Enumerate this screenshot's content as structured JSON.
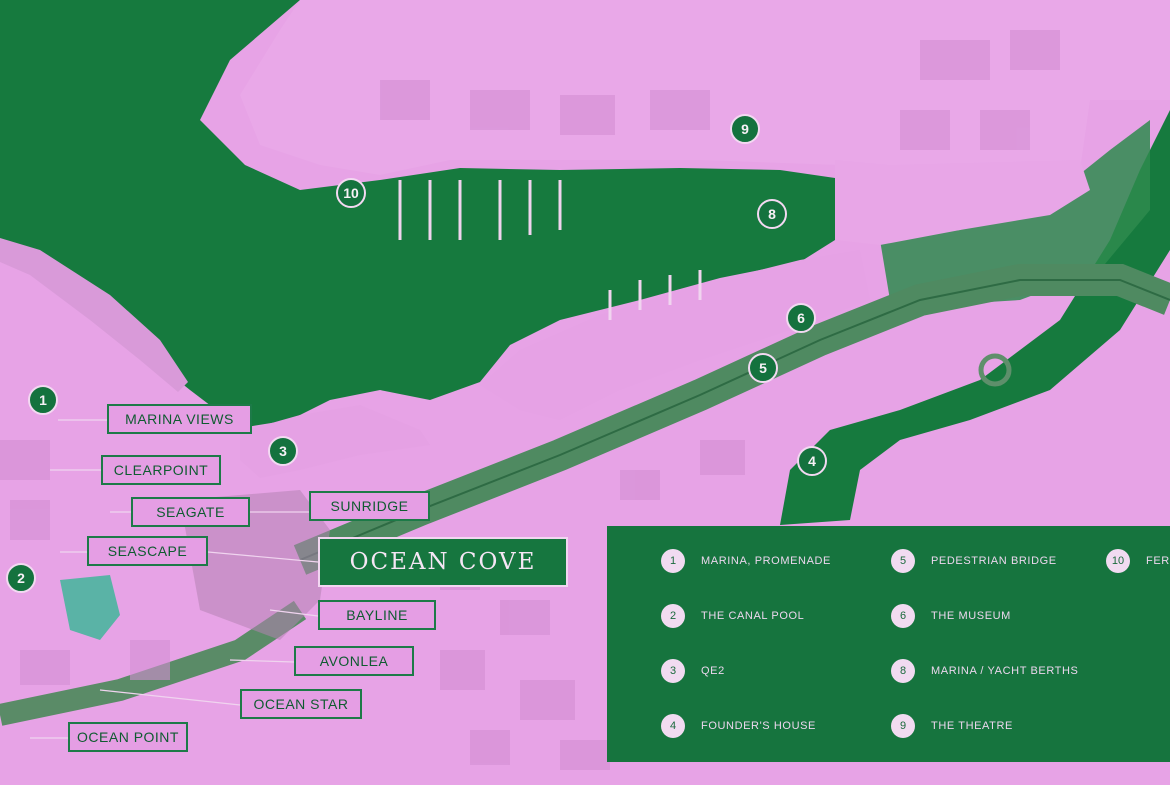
{
  "map": {
    "colors": {
      "water": "#167a3e",
      "land": "#e7a3e6",
      "accent": "#14723e",
      "label_border": "#1d7a48"
    }
  },
  "pins": [
    "1",
    "2",
    "3",
    "4",
    "5",
    "6",
    "8",
    "9",
    "10"
  ],
  "buildings": [
    "MARINA VIEWS",
    "CLEARPOINT",
    "SEAGATE",
    "SUNRIDGE",
    "SEASCAPE",
    "BAYLINE",
    "AVONLEA",
    "OCEAN STAR",
    "OCEAN POINT"
  ],
  "project_title": "OCEAN COVE",
  "legend": [
    {
      "num": "1",
      "label": "MARINA, PROMENADE"
    },
    {
      "num": "2",
      "label": "THE CANAL POOL"
    },
    {
      "num": "3",
      "label": "QE2"
    },
    {
      "num": "4",
      "label": "FOUNDER'S HOUSE"
    },
    {
      "num": "5",
      "label": "PEDESTRIAN BRIDGE"
    },
    {
      "num": "6",
      "label": "THE MUSEUM"
    },
    {
      "num": "8",
      "label": "MARINA / YACHT BERTHS"
    },
    {
      "num": "9",
      "label": "THE THEATRE"
    },
    {
      "num": "10",
      "label": "FER"
    }
  ]
}
